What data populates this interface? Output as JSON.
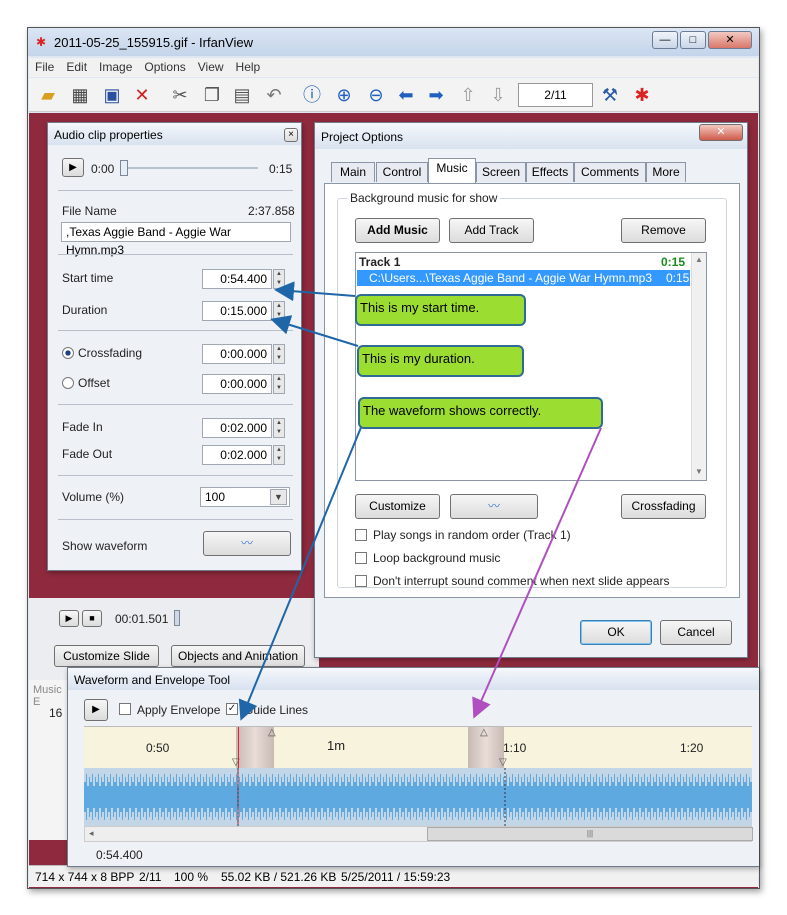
{
  "window": {
    "title": "2011-05-25_155915.gif - IrfanView",
    "min": "—",
    "max": "□",
    "close": "✕"
  },
  "menu": [
    "File",
    "Edit",
    "Image",
    "Options",
    "View",
    "Help"
  ],
  "toolbar": {
    "page": "2/11",
    "icons": [
      "open-icon",
      "slideshow-icon",
      "save-icon",
      "delete-icon",
      "cut-icon",
      "copy-icon",
      "paste-icon",
      "undo-icon",
      "info-icon",
      "zoom-in-icon",
      "zoom-out-icon",
      "previous-icon",
      "next-icon",
      "first-page-icon",
      "last-page-icon",
      "settings-icon",
      "irfanview-logo-icon"
    ]
  },
  "audio": {
    "title": "Audio clip properties",
    "close": "×",
    "play_time": "0:00",
    "end_time": "0:15",
    "filename_label": "File Name",
    "filename_length": "2:37.858",
    "filename": ",Texas Aggie Band - Aggie War Hymn.mp3",
    "start_label": "Start time",
    "start": "0:54.400",
    "duration_label": "Duration",
    "duration": "0:15.000",
    "crossfading_label": "Crossfading",
    "crossfading": "0:00.000",
    "offset_label": "Offset",
    "offset": "0:00.000",
    "fadein_label": "Fade In",
    "fadein": "0:02.000",
    "fadeout_label": "Fade Out",
    "fadeout": "0:02.000",
    "volume_label": "Volume (%)",
    "volume": "100",
    "waveform_label": "Show waveform"
  },
  "project": {
    "title": "Project Options",
    "close": "✕",
    "tabs": [
      "Main",
      "Control",
      "Music",
      "Screen",
      "Effects",
      "Comments",
      "More"
    ],
    "group": "Background music for show",
    "add_music": "Add Music",
    "add_track": "Add Track",
    "remove": "Remove",
    "track": "Track 1",
    "track_time": "0:15",
    "file": "C:\\Users...\\Texas Aggie Band - Aggie War Hymn.mp3",
    "file_time": "0:15",
    "customize": "Customize",
    "crossfading": "Crossfading",
    "chk_random": "Play songs in random order (Track 1)",
    "chk_loop": "Loop background music",
    "chk_interrupt": "Don't interrupt sound comment when next slide appears",
    "ok": "OK",
    "cancel": "Cancel"
  },
  "slide": {
    "time": "00:01.501",
    "customize": "Customize Slide",
    "objects": "Objects and Animation",
    "music_label": "Music E",
    "number": "16"
  },
  "waveform": {
    "title": "Waveform and Envelope Tool",
    "apply_envelope": "Apply Envelope",
    "guide_lines": "Guide Lines",
    "ticks": [
      "0:50",
      "1m",
      "1:10",
      "1:20"
    ],
    "position": "0:54.400",
    "scroll_grip": "|||"
  },
  "callouts": {
    "start": "This is my start time.",
    "duration": "This is my duration.",
    "waveform": "The waveform shows correctly."
  },
  "status": {
    "dims": "714 x 744 x 8 BPP",
    "page": "2/11",
    "zoom": "100 %",
    "size": "55.02 KB / 521.26 KB",
    "date": "5/25/2011 / 15:59:23"
  },
  "colors": {
    "accent": "#3399ff",
    "callout": "#9cdd32",
    "arrow_blue": "#1f66a8",
    "arrow_purple": "#b04fbf",
    "track_green": "#1a8a1a"
  }
}
